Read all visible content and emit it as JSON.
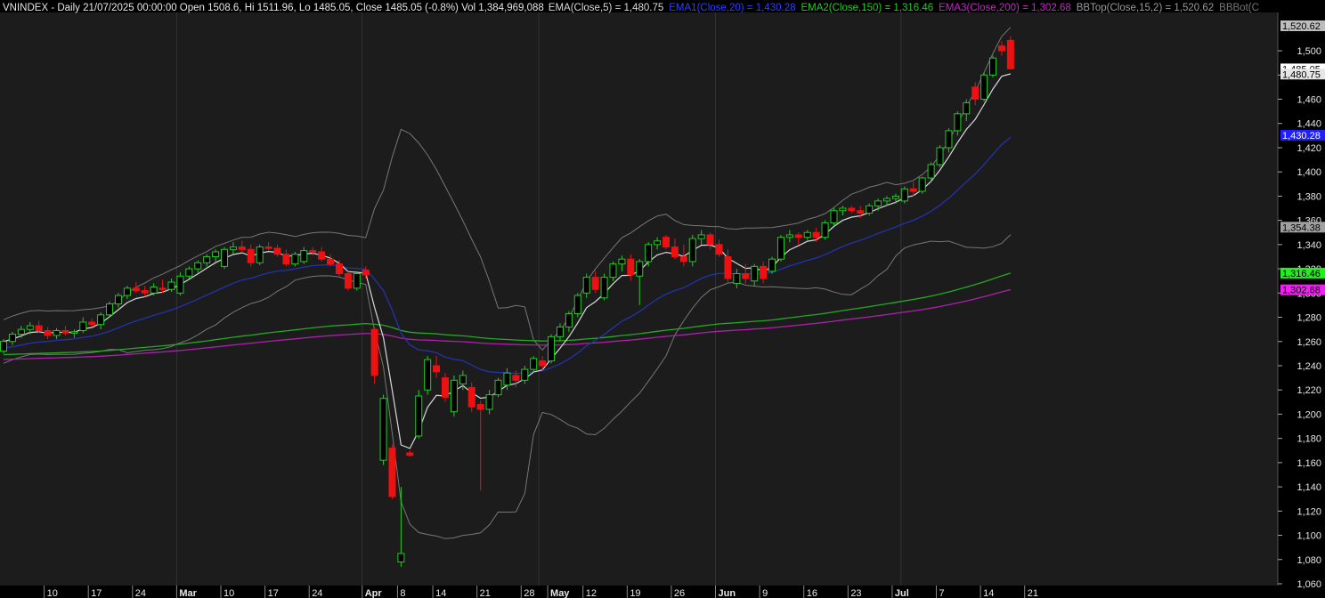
{
  "header": {
    "symbol": "VNINDEX",
    "summary": "VNINDEX - Daily 21/07/2025 00:00:00 Open 1508.6, Hi 1511.96, Lo 1485.05, Close 1485.05 (-0.8%) Vol 1,384,969,088",
    "indicators": [
      {
        "label": "EMA(Close,5) = 1,480.75",
        "color": "#d9d9d9"
      },
      {
        "label": "EMA1(Close,20) = 1,430.28",
        "color": "#2f3fff"
      },
      {
        "label": "EMA2(Close,150) = 1,316.46",
        "color": "#22cc22"
      },
      {
        "label": "EMA3(Close,200) = 1,302.68",
        "color": "#cc22cc"
      },
      {
        "label": "BBTop(Close,15,2) = 1,520.62",
        "color": "#9a9a9a"
      },
      {
        "label": "BBBot(C",
        "color": "#777777"
      }
    ]
  },
  "value_tags": [
    {
      "label": "1,520.62",
      "value": 1520.62,
      "bg": "#bdbdbd",
      "fg": "#000000"
    },
    {
      "label": "1,485.05",
      "value": 1485.05,
      "bg": "#ffffff",
      "fg": "#000000"
    },
    {
      "label": "1,480.75",
      "value": 1480.75,
      "bg": "#e6e6e6",
      "fg": "#000000"
    },
    {
      "label": "1,430.28",
      "value": 1430.28,
      "bg": "#1f1fff",
      "fg": "#ffffff"
    },
    {
      "label": "1,354.38",
      "value": 1354.38,
      "bg": "#a0a0a0",
      "fg": "#000000"
    },
    {
      "label": "1,316.46",
      "value": 1316.46,
      "bg": "#22ee22",
      "fg": "#000000"
    },
    {
      "label": "1,302.68",
      "value": 1302.68,
      "bg": "#ee22ee",
      "fg": "#000000"
    }
  ],
  "colors": {
    "background": "#000000",
    "grid": "#333333",
    "up": "#22cc22",
    "down": "#ee1111",
    "ema5": "#d9d9d9",
    "ema20": "#2233aa",
    "ema150": "#22aa22",
    "ema200": "#aa22aa",
    "bband": "#777777"
  },
  "chart_data": {
    "type": "candlestick",
    "title": "VNINDEX - Daily",
    "ylim": [
      1060,
      1530
    ],
    "yticks": [
      1060,
      1080,
      1100,
      1120,
      1140,
      1160,
      1180,
      1200,
      1220,
      1240,
      1260,
      1280,
      1300,
      1320,
      1340,
      1360,
      1380,
      1400,
      1420,
      1440,
      1460,
      1480,
      1500
    ],
    "ytick_labels": [
      "1,060",
      "1,080",
      "1,100",
      "1,120",
      "1,140",
      "1,160",
      "1,180",
      "1,200",
      "1,220",
      "1,240",
      "1,260",
      "1,280",
      "1,300",
      "1,320",
      "1,340",
      "1,360",
      "1,380",
      "1,400",
      "1,420",
      "1,440",
      "1,460",
      "1,480",
      "1,500"
    ],
    "xtick_labels": [
      {
        "label": "10",
        "index": 5,
        "bold": false
      },
      {
        "label": "17",
        "index": 10,
        "bold": false
      },
      {
        "label": "24",
        "index": 15,
        "bold": false
      },
      {
        "label": "Mar",
        "index": 20,
        "bold": true
      },
      {
        "label": "10",
        "index": 25,
        "bold": false
      },
      {
        "label": "17",
        "index": 30,
        "bold": false
      },
      {
        "label": "24",
        "index": 35,
        "bold": false
      },
      {
        "label": "Apr",
        "index": 41,
        "bold": true
      },
      {
        "label": "8",
        "index": 45,
        "bold": false
      },
      {
        "label": "14",
        "index": 49,
        "bold": false
      },
      {
        "label": "21",
        "index": 54,
        "bold": false
      },
      {
        "label": "28",
        "index": 59,
        "bold": false
      },
      {
        "label": "May",
        "index": 62,
        "bold": true
      },
      {
        "label": "12",
        "index": 66,
        "bold": false
      },
      {
        "label": "19",
        "index": 71,
        "bold": false
      },
      {
        "label": "26",
        "index": 76,
        "bold": false
      },
      {
        "label": "Jun",
        "index": 81,
        "bold": true
      },
      {
        "label": "9",
        "index": 86,
        "bold": false
      },
      {
        "label": "16",
        "index": 91,
        "bold": false
      },
      {
        "label": "23",
        "index": 96,
        "bold": false
      },
      {
        "label": "Jul",
        "index": 101,
        "bold": true
      },
      {
        "label": "7",
        "index": 106,
        "bold": false
      },
      {
        "label": "14",
        "index": 111,
        "bold": false
      },
      {
        "label": "21",
        "index": 116,
        "bold": false
      }
    ],
    "grid_indices": [
      20,
      41,
      61,
      81,
      102
    ],
    "candles": [
      [
        1252,
        1262,
        1250,
        1260
      ],
      [
        1260,
        1268,
        1257,
        1266
      ],
      [
        1266,
        1273,
        1263,
        1270
      ],
      [
        1270,
        1276,
        1266,
        1273
      ],
      [
        1273,
        1277,
        1267,
        1269
      ],
      [
        1269,
        1272,
        1262,
        1265
      ],
      [
        1265,
        1271,
        1262,
        1269
      ],
      [
        1269,
        1273,
        1265,
        1267
      ],
      [
        1267,
        1270,
        1263,
        1268
      ],
      [
        1269,
        1280,
        1267,
        1276
      ],
      [
        1276,
        1279,
        1272,
        1274
      ],
      [
        1274,
        1284,
        1270,
        1282
      ],
      [
        1282,
        1293,
        1280,
        1291
      ],
      [
        1291,
        1300,
        1288,
        1298
      ],
      [
        1298,
        1306,
        1295,
        1304
      ],
      [
        1304,
        1309,
        1300,
        1302
      ],
      [
        1302,
        1306,
        1297,
        1300
      ],
      [
        1300,
        1308,
        1298,
        1305
      ],
      [
        1304,
        1311,
        1300,
        1303
      ],
      [
        1303,
        1312,
        1301,
        1309
      ],
      [
        1300,
        1317,
        1298,
        1314
      ],
      [
        1314,
        1322,
        1312,
        1320
      ],
      [
        1320,
        1327,
        1317,
        1325
      ],
      [
        1325,
        1332,
        1322,
        1330
      ],
      [
        1330,
        1336,
        1326,
        1334
      ],
      [
        1322,
        1338,
        1320,
        1336
      ],
      [
        1336,
        1342,
        1332,
        1338
      ],
      [
        1338,
        1343,
        1334,
        1336
      ],
      [
        1336,
        1340,
        1322,
        1325
      ],
      [
        1325,
        1340,
        1323,
        1338
      ],
      [
        1338,
        1342,
        1335,
        1337
      ],
      [
        1337,
        1340,
        1330,
        1332
      ],
      [
        1332,
        1336,
        1322,
        1324
      ],
      [
        1324,
        1334,
        1322,
        1332
      ],
      [
        1326,
        1338,
        1324,
        1335
      ],
      [
        1335,
        1338,
        1331,
        1334
      ],
      [
        1334,
        1338,
        1326,
        1328
      ],
      [
        1328,
        1332,
        1322,
        1324
      ],
      [
        1324,
        1327,
        1314,
        1316
      ],
      [
        1316,
        1318,
        1302,
        1304
      ],
      [
        1304,
        1318,
        1302,
        1316
      ],
      [
        1319,
        1322,
        1312,
        1315
      ],
      [
        1270,
        1272,
        1225,
        1232
      ],
      [
        1162,
        1216,
        1158,
        1213
      ],
      [
        1172,
        1175,
        1130,
        1132
      ],
      [
        1078,
        1140,
        1074,
        1085
      ],
      [
        1168,
        1170,
        1165,
        1166
      ],
      [
        1182,
        1220,
        1180,
        1215
      ],
      [
        1220,
        1248,
        1216,
        1245
      ],
      [
        1240,
        1248,
        1230,
        1235
      ],
      [
        1230,
        1234,
        1210,
        1214
      ],
      [
        1202,
        1232,
        1198,
        1228
      ],
      [
        1225,
        1236,
        1220,
        1232
      ],
      [
        1222,
        1226,
        1202,
        1206
      ],
      [
        1208,
        1211,
        1137,
        1204
      ],
      [
        1204,
        1220,
        1200,
        1216
      ],
      [
        1216,
        1230,
        1214,
        1228
      ],
      [
        1224,
        1238,
        1220,
        1234
      ],
      [
        1232,
        1236,
        1222,
        1228
      ],
      [
        1228,
        1240,
        1225,
        1237
      ],
      [
        1237,
        1248,
        1234,
        1246
      ],
      [
        1244,
        1248,
        1236,
        1240
      ],
      [
        1244,
        1266,
        1242,
        1264
      ],
      [
        1264,
        1275,
        1260,
        1272
      ],
      [
        1272,
        1285,
        1268,
        1283
      ],
      [
        1283,
        1300,
        1280,
        1298
      ],
      [
        1300,
        1316,
        1296,
        1313
      ],
      [
        1313,
        1318,
        1300,
        1303
      ],
      [
        1296,
        1316,
        1294,
        1313
      ],
      [
        1313,
        1326,
        1310,
        1324
      ],
      [
        1324,
        1331,
        1318,
        1328
      ],
      [
        1328,
        1332,
        1310,
        1315
      ],
      [
        1314,
        1328,
        1290,
        1326
      ],
      [
        1326,
        1342,
        1322,
        1340
      ],
      [
        1340,
        1346,
        1336,
        1343
      ],
      [
        1346,
        1348,
        1336,
        1338
      ],
      [
        1338,
        1345,
        1328,
        1330
      ],
      [
        1330,
        1340,
        1322,
        1326
      ],
      [
        1326,
        1348,
        1322,
        1345
      ],
      [
        1345,
        1352,
        1340,
        1348
      ],
      [
        1348,
        1350,
        1336,
        1340
      ],
      [
        1340,
        1344,
        1330,
        1332
      ],
      [
        1330,
        1336,
        1308,
        1312
      ],
      [
        1308,
        1320,
        1304,
        1316
      ],
      [
        1316,
        1324,
        1308,
        1312
      ],
      [
        1310,
        1324,
        1306,
        1322
      ],
      [
        1322,
        1326,
        1308,
        1312
      ],
      [
        1318,
        1330,
        1316,
        1328
      ],
      [
        1328,
        1348,
        1326,
        1346
      ],
      [
        1346,
        1352,
        1342,
        1348
      ],
      [
        1348,
        1350,
        1340,
        1346
      ],
      [
        1346,
        1352,
        1344,
        1350
      ],
      [
        1350,
        1354,
        1342,
        1346
      ],
      [
        1346,
        1360,
        1344,
        1358
      ],
      [
        1358,
        1370,
        1356,
        1368
      ],
      [
        1368,
        1372,
        1364,
        1370
      ],
      [
        1370,
        1372,
        1366,
        1368
      ],
      [
        1368,
        1372,
        1362,
        1366
      ],
      [
        1366,
        1374,
        1364,
        1372
      ],
      [
        1372,
        1378,
        1368,
        1376
      ],
      [
        1376,
        1380,
        1372,
        1378
      ],
      [
        1378,
        1382,
        1374,
        1380
      ],
      [
        1376,
        1388,
        1374,
        1386
      ],
      [
        1386,
        1392,
        1380,
        1384
      ],
      [
        1384,
        1396,
        1382,
        1395
      ],
      [
        1395,
        1408,
        1392,
        1406
      ],
      [
        1406,
        1422,
        1404,
        1420
      ],
      [
        1420,
        1436,
        1416,
        1434
      ],
      [
        1434,
        1450,
        1430,
        1448
      ],
      [
        1448,
        1460,
        1442,
        1457
      ],
      [
        1470,
        1474,
        1455,
        1460
      ],
      [
        1460,
        1482,
        1458,
        1480
      ],
      [
        1480,
        1496,
        1478,
        1494
      ],
      [
        1504,
        1508,
        1496,
        1500
      ],
      [
        1508.6,
        1511.96,
        1485.05,
        1485.05
      ]
    ]
  }
}
